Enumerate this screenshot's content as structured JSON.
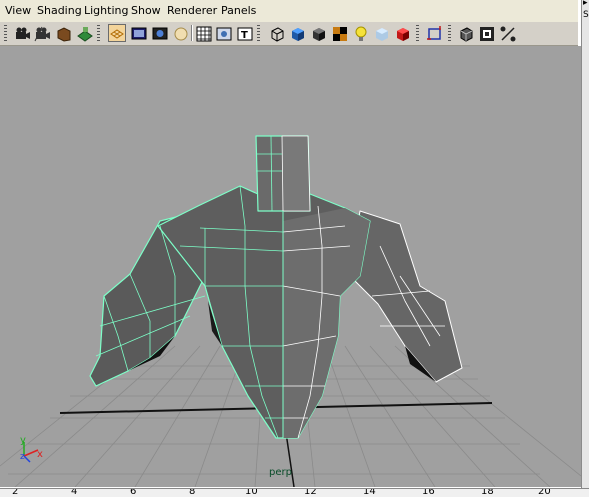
{
  "menu": [
    "View",
    "Shading",
    "Lighting",
    "Show",
    "Renderer",
    "Panels"
  ],
  "toolbar_icons": [
    "camera-select-icon",
    "camera-attributes-icon",
    "bookmark-icon",
    "image-plane-icon",
    "grid-toggle-icon",
    "film-gate-icon",
    "resolution-gate-icon",
    "safe-action-icon",
    "field-chart-icon",
    "safe-title-icon",
    "textured-icon",
    "wireframe-icon",
    "smooth-shade-icon",
    "flat-shade-icon",
    "default-material-icon",
    "use-all-lights-icon",
    "xray-icon",
    "shaded-wireframe-icon",
    "isolate-select-icon",
    "xray-joints-icon",
    "hud-icon",
    "texture-filter-icon"
  ],
  "viewport": {
    "camera_label": "perp",
    "axis_labels": {
      "y": "y",
      "x": "x",
      "z": "z"
    },
    "background": "#a0a0a0",
    "wire_color": "#7dffc8"
  },
  "right_strip": [
    "▸",
    "S"
  ],
  "ruler": {
    "ticks": [
      "2",
      "4",
      "6",
      "8",
      "10",
      "12",
      "14",
      "16",
      "18",
      "20"
    ]
  }
}
